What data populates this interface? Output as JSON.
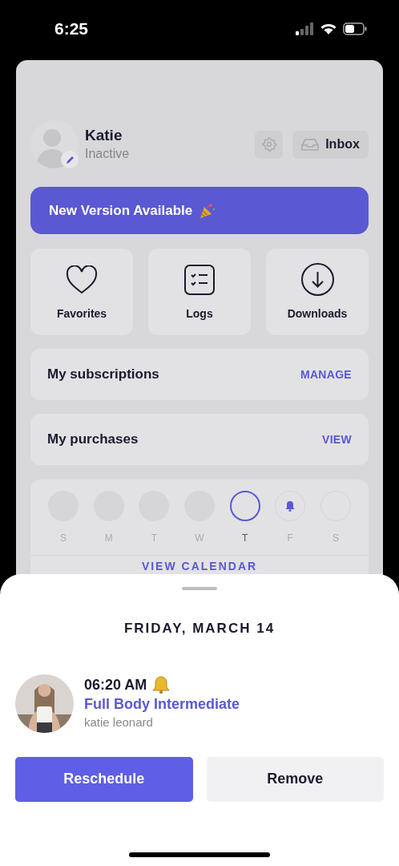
{
  "status_bar": {
    "time": "6:25"
  },
  "profile": {
    "name": "Katie",
    "status": "Inactive"
  },
  "header_buttons": [
    {
      "kind": "settings"
    },
    {
      "kind": "inbox",
      "label": "Inbox"
    }
  ],
  "banner": {
    "text": "New Version Available"
  },
  "tiles": [
    {
      "kind": "heart",
      "label": "Favorites"
    },
    {
      "kind": "checklist",
      "label": "Logs"
    },
    {
      "kind": "download",
      "label": "Downloads"
    }
  ],
  "rows": [
    {
      "title": "My subscriptions",
      "action": "MANAGE"
    },
    {
      "title": "My purchases",
      "action": "VIEW"
    }
  ],
  "week": {
    "days": [
      {
        "letter": "S",
        "kind": "past"
      },
      {
        "letter": "M",
        "kind": "past"
      },
      {
        "letter": "T",
        "kind": "past"
      },
      {
        "letter": "W",
        "kind": "past"
      },
      {
        "letter": "T",
        "kind": "today"
      },
      {
        "letter": "F",
        "kind": "scheduled"
      },
      {
        "letter": "S",
        "kind": "future"
      }
    ],
    "link": "VIEW CALENDAR"
  },
  "sheet": {
    "title": "FRIDAY, MARCH 14",
    "event": {
      "time": "06:20 AM",
      "reminder": true,
      "workout": "Full Body Intermediate",
      "trainer": "katie leonard"
    },
    "buttons": [
      {
        "label": "Reschedule",
        "kind": "primary"
      },
      {
        "label": "Remove",
        "kind": "secondary"
      }
    ]
  }
}
